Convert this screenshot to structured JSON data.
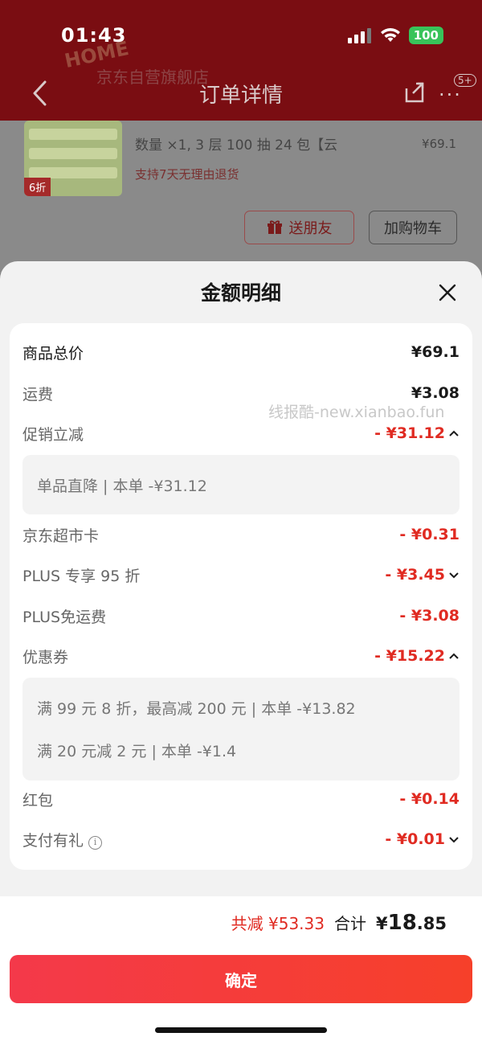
{
  "status_bar": {
    "time": "01:43",
    "battery": "100"
  },
  "background": {
    "nav_title": "订单详情",
    "more_badge": "5+",
    "store_name": "京东自营旗舰店",
    "store_logo": "HOME",
    "product_qty": "数量 ×1, 3 层 100 抽 24 包【云",
    "product_price": "¥69.1",
    "product_discount_tag": "6折",
    "return_policy": "支持7天无理由退货",
    "gift_button": "送朋友",
    "cart_button": "加购物车"
  },
  "sheet": {
    "title": "金额明细",
    "rows": [
      {
        "label": "商品总价",
        "value": "¥69.1"
      },
      {
        "label": "运费",
        "value": "¥3.08"
      },
      {
        "label": "促销立减",
        "value": "- ¥31.12",
        "chevron": "up"
      },
      {
        "label": "京东超市卡",
        "value": "- ¥0.31"
      },
      {
        "label": "PLUS 专享 95 折",
        "value": "- ¥3.45",
        "chevron": "down"
      },
      {
        "label": "PLUS免运费",
        "value": "- ¥3.08"
      },
      {
        "label": "优惠券",
        "value": "- ¥15.22",
        "chevron": "up"
      },
      {
        "label": "红包",
        "value": "- ¥0.14"
      },
      {
        "label": "支付有礼",
        "value": "- ¥0.01",
        "chevron": "down",
        "info_icon": "i"
      }
    ],
    "promo_details": [
      "单品直降 | 本单 -¥31.12"
    ],
    "coupon_details": [
      "满 99 元 8 折，最高减 200 元 | 本单 -¥13.82",
      "满 20 元减 2 元 | 本单 -¥1.4"
    ],
    "watermark": "线报酷-new.xianbao.fun"
  },
  "footer": {
    "reduce_total": "共减 ¥53.33",
    "total_label": "合计",
    "total_currency": "¥",
    "total_int": "18",
    "total_dec": ".85",
    "confirm_label": "确定"
  },
  "colors": {
    "accent_red": "#e02b22",
    "button_gradient_start": "#f4394a",
    "button_gradient_end": "#f6402a"
  }
}
